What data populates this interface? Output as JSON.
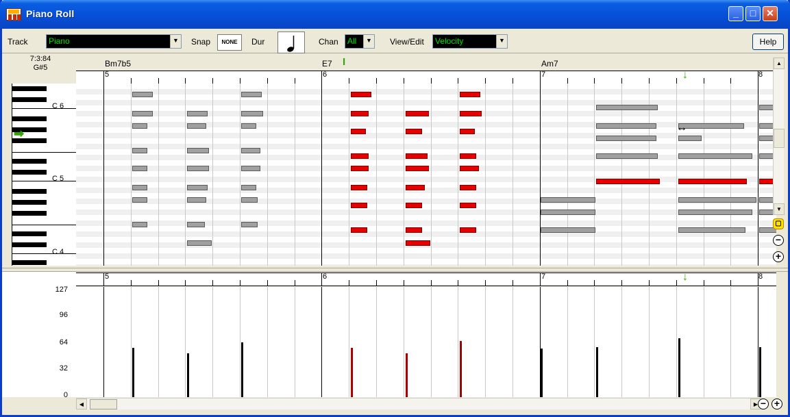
{
  "window": {
    "title": "Piano Roll"
  },
  "toolbar": {
    "track_label": "Track",
    "track_value": "Piano",
    "snap_label": "Snap",
    "snap_value": "NONE",
    "dur_label": "Dur",
    "chan_label": "Chan",
    "chan_value": "All",
    "view_label": "View/Edit",
    "view_value": "Velocity",
    "help_label": "Help"
  },
  "position": {
    "time": "7:3:84",
    "note": "G#5"
  },
  "chords": [
    "Bm7b5",
    "E7",
    "Am7"
  ],
  "bars": [
    "5",
    "6",
    "7",
    "8"
  ],
  "octaves": [
    "C 6",
    "C 5",
    "C 4"
  ],
  "velocity_axis": [
    "127",
    "96",
    "64",
    "32",
    "0"
  ],
  "colors": {
    "title_bar": "#0a5ee0",
    "note_selected": "#e80000",
    "note": "#a0a0a0",
    "combo_bg": "#000000",
    "combo_text": "#00e000"
  }
}
